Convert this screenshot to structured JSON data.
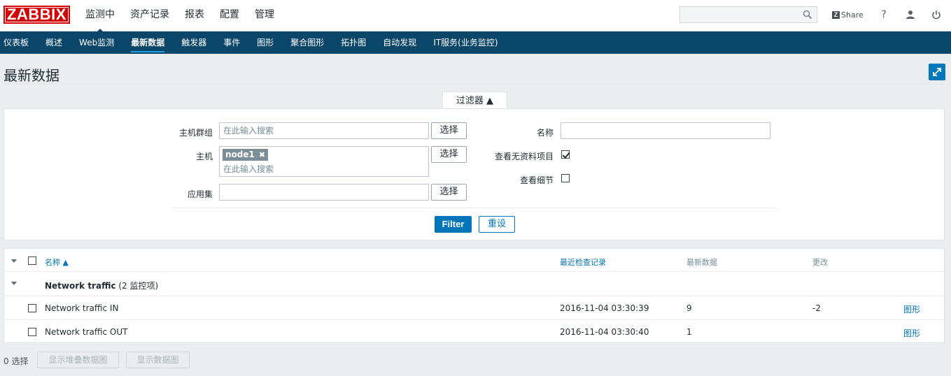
{
  "app": {
    "logo_text": "ZABBIX"
  },
  "main_nav": [
    "监测中",
    "资产记录",
    "报表",
    "配置",
    "管理"
  ],
  "header_tools": {
    "share_label": "Share",
    "help_label": "?"
  },
  "sub_nav": [
    "仪表板",
    "概述",
    "Web监测",
    "最新数据",
    "触发器",
    "事件",
    "图形",
    "聚合图形",
    "拓扑图",
    "自动发现",
    "IT服务(业务监控)"
  ],
  "page": {
    "title": "最新数据"
  },
  "filter": {
    "tab_label": "过滤器 ▲",
    "host_group_label": "主机群组",
    "host_group_placeholder": "在此输入搜索",
    "host_label": "主机",
    "host_tag": "node1",
    "host_placeholder": "在此输入搜索",
    "application_label": "应用集",
    "select_label": "选择",
    "name_label": "名称",
    "show_no_data_label": "查看无资料项目",
    "show_no_data_checked": true,
    "show_details_label": "查看细节",
    "show_details_checked": false,
    "filter_button": "Filter",
    "reset_button": "重设"
  },
  "table": {
    "headers": {
      "name": "名称 ▲",
      "last_check": "最近检查记录",
      "last_value": "最新数据",
      "change": "更改"
    },
    "group": {
      "name": "Network traffic",
      "count_text": "(2 监控项)"
    },
    "rows": [
      {
        "name": "Network traffic IN",
        "last_check": "2016-11-04 03:30:39",
        "last_value": "9",
        "change": "-2",
        "link": "图形"
      },
      {
        "name": "Network traffic OUT",
        "last_check": "2016-11-04 03:30:40",
        "last_value": "1",
        "change": "",
        "link": "图形"
      }
    ]
  },
  "footer": {
    "selected_count": "0 选择",
    "stacked_graph_button": "显示堆叠数据图",
    "graph_button": "显示数据图"
  }
}
